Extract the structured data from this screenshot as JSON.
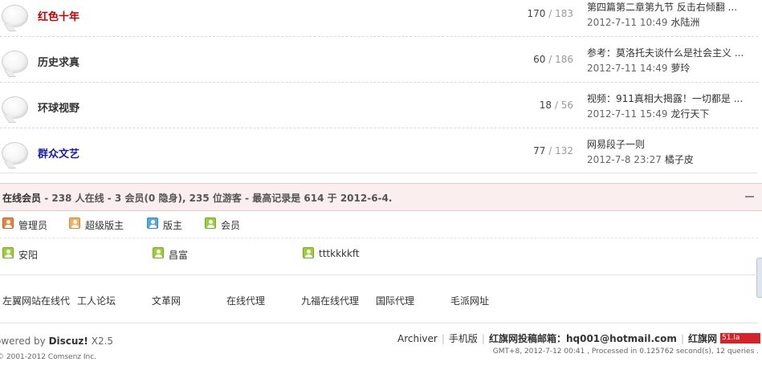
{
  "forums": [
    {
      "name": "红色十年",
      "name_color": "#c00000",
      "threads": "170",
      "sep": " / ",
      "posts": "183",
      "last_title": "第四篇第二章第九节 反击右倾翻 ...",
      "last_time": "2012-7-11 10:49",
      "last_author": "水陆洲"
    },
    {
      "name": "历史求真",
      "name_color": "#333333",
      "threads": "60",
      "sep": " / ",
      "posts": "186",
      "last_title": "参考：莫洛托夫谈什么是社会主义 ...",
      "last_time": "2012-7-11 14:49",
      "last_author": "萝玲"
    },
    {
      "name": "环球视野",
      "name_color": "#333333",
      "threads": "18",
      "sep": " / ",
      "posts": "56",
      "last_title": "视频：911真相大揭露！一切都是 ...",
      "last_time": "2012-7-11 15:49",
      "last_author": "龙行天下"
    },
    {
      "name": "群众文艺",
      "name_color": "#1a1aa6",
      "threads": "77",
      "sep": " / ",
      "posts": "132",
      "last_title": "网易段子一则",
      "last_time": "2012-7-8 23:27",
      "last_author": "橘子皮"
    }
  ],
  "online": {
    "label": "在线会员",
    "summary": " - 238 人在线 - 3 会员(0 隐身), 235 位游客 - 最高记录是 614 于 2012-6-4."
  },
  "legend": [
    {
      "icon": "admin-icon",
      "label": "管理员"
    },
    {
      "icon": "super-moderator-icon",
      "label": "超级版主"
    },
    {
      "icon": "moderator-icon",
      "label": "版主"
    },
    {
      "icon": "member-icon",
      "label": "会员"
    }
  ],
  "online_users": [
    "安阳",
    "昌富",
    "tttkkkkft"
  ],
  "friend_links": [
    "左翼网站在线代",
    "工人论坛",
    "文革网",
    "在线代理",
    "九福在线代理",
    "国际代理",
    "毛派网址"
  ],
  "footer": {
    "powered_prefix": "owered by ",
    "powered_brand": "Discuz!",
    "powered_version": " X2.5",
    "copyright": "2001-2012 Comsenz Inc.",
    "archiver": "Archiver",
    "mobile": "手机版",
    "contact_label": "红旗网投稿邮箱：hq001@hotmail.com",
    "site_name": "红旗网",
    "stats_badge": "51.la",
    "gmt_info": "GMT+8, 2012-7-12 00:41 , Processed in 0.125762 second(s), 12 queries ."
  },
  "colors": {
    "accent_red": "#c00000",
    "online_bar_bg": "#fbeeee",
    "stats_badge": "#d4232b"
  }
}
